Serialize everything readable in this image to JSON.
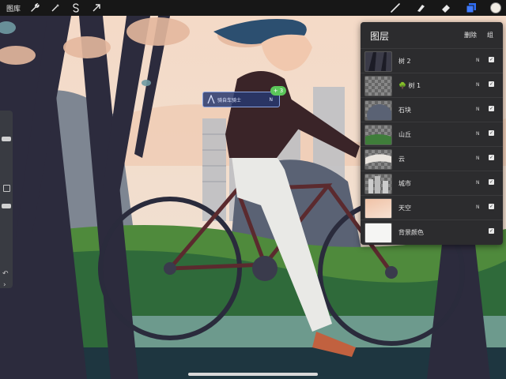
{
  "toolbar": {
    "gallery_label": "图库",
    "left_icons": [
      "wrench-icon",
      "magic-wand-icon",
      "selection-s-icon",
      "transform-arrow-icon"
    ],
    "right_icons": [
      "brush-icon",
      "smudge-icon",
      "eraser-icon",
      "layers-icon"
    ],
    "current_color": "#f2ede4"
  },
  "selection_tag": {
    "label": "骑自车骑士",
    "mode": "N",
    "badge": "+ 3"
  },
  "layers_panel": {
    "title": "图层",
    "delete_label": "删除",
    "group_label": "组",
    "layers": [
      {
        "name": "树 2",
        "mode": "N",
        "visible": true
      },
      {
        "name": "树 1",
        "mode": "N",
        "visible": true
      },
      {
        "name": "石块",
        "mode": "N",
        "visible": true
      },
      {
        "name": "山丘",
        "mode": "N",
        "visible": true
      },
      {
        "name": "云",
        "mode": "N",
        "visible": true
      },
      {
        "name": "城市",
        "mode": "N",
        "visible": true
      },
      {
        "name": "天空",
        "mode": "N",
        "visible": true
      },
      {
        "name": "背景颜色",
        "mode": "",
        "visible": true
      }
    ]
  },
  "colors": {
    "accent_blue": "#2f6df6",
    "panel_bg": "#2c2c2e",
    "badge_green": "#5bc65a"
  }
}
